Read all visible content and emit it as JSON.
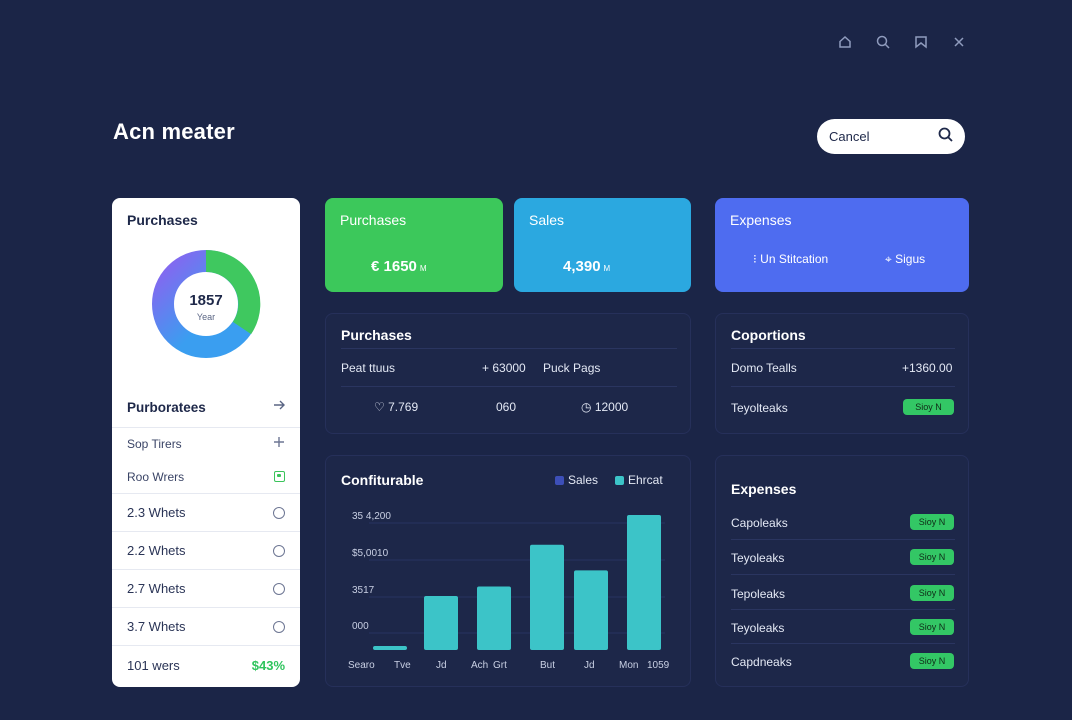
{
  "app": {
    "title": "Acn meater"
  },
  "window_controls": [
    {
      "name": "home-icon"
    },
    {
      "name": "search-icon"
    },
    {
      "name": "bookmark-icon"
    },
    {
      "name": "close-icon"
    }
  ],
  "search": {
    "value": "Cancel"
  },
  "left_panel": {
    "title": "Purchases",
    "donut_value": "1857",
    "donut_sub": "Year",
    "donut_colors": [
      "#8a63f0",
      "#3a9ef0",
      "#3fc85f"
    ],
    "section_title": "Purboratees",
    "rows": [
      {
        "label": "Sop Tirers",
        "control": "plus"
      },
      {
        "label": "Roo Wrers",
        "control": "check"
      },
      {
        "label": "2.3 Whets",
        "control": "radio"
      },
      {
        "label": "2.2 Whets",
        "control": "radio"
      },
      {
        "label": "2.7 Whets",
        "control": "radio"
      },
      {
        "label": "3.7 Whets",
        "control": "radio"
      },
      {
        "label": "101 wers",
        "control": "pct",
        "value": "$43%"
      }
    ]
  },
  "cards": {
    "purchases": {
      "title": "Purchases",
      "value": "€ 1650",
      "unit": "M"
    },
    "sales": {
      "title": "Sales",
      "value": "4,390",
      "unit": "M"
    },
    "expenses": {
      "title": "Expenses",
      "opt1": "Un Stitcation",
      "opt2": "Sigus"
    }
  },
  "purchases_panel": {
    "title": "Purchases",
    "row1": {
      "label": "Peat ttuus",
      "value": "+ 63000",
      "extra": "Puck Pags"
    },
    "row2": {
      "a": "7.769",
      "b": "060",
      "c": "12000"
    }
  },
  "coportions_panel": {
    "title": "Coportions",
    "row1": {
      "label": "Domo Tealls",
      "value": "+1360.00"
    },
    "row2": {
      "label": "Teyolteaks",
      "pill": "Sioy N"
    }
  },
  "chart_data": {
    "type": "bar",
    "title": "Confiturable",
    "legend": [
      {
        "name": "Sales",
        "color": "#3d4fb8"
      },
      {
        "name": "Ehrcat",
        "color": "#3cc4c8"
      }
    ],
    "y_tick_labels": [
      "35 4,200",
      "$5,0010",
      "3517",
      "000"
    ],
    "categories": [
      "Searo",
      "Tve",
      "Jd",
      "Ach",
      "Grt",
      "But",
      "Jd",
      "Mon",
      "1059"
    ],
    "values": [
      3,
      0,
      0,
      40,
      47,
      78,
      59,
      100,
      0
    ],
    "ylim": [
      0,
      100
    ],
    "bar_color": "#3cc4c8"
  },
  "expenses_panel": {
    "title": "Expenses",
    "rows": [
      {
        "label": "Capoleaks",
        "pill": "Sioy N"
      },
      {
        "label": "Teyoleaks",
        "pill": "Sioy N"
      },
      {
        "label": "Tepoleaks",
        "pill": "Sioy N"
      },
      {
        "label": "Teyoleaks",
        "pill": "Sioy N"
      },
      {
        "label": "Capdneaks",
        "pill": "Sioy N"
      }
    ]
  }
}
